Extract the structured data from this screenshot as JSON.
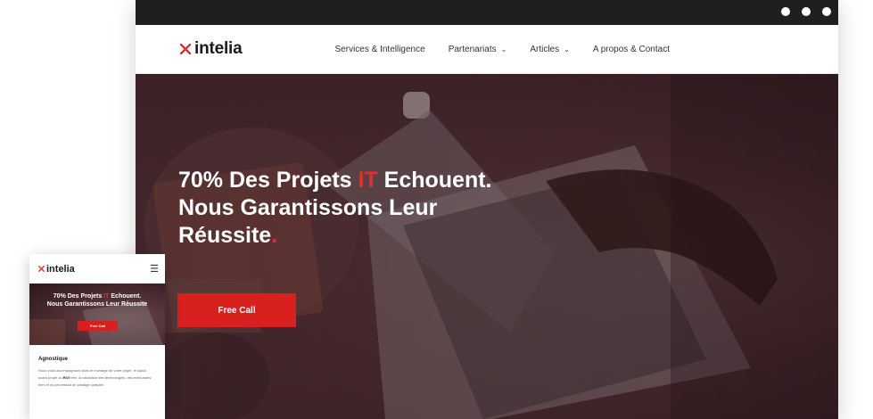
{
  "window": {
    "dots": [
      "dot",
      "dot",
      "dot"
    ]
  },
  "desktop": {
    "logo": "intelia",
    "nav": [
      {
        "label": "Services & Intelligence",
        "dropdown": false
      },
      {
        "label": "Partenariats",
        "dropdown": true
      },
      {
        "label": "Articles",
        "dropdown": true
      },
      {
        "label": "A propos & Contact",
        "dropdown": false
      }
    ],
    "hero": {
      "line1_before": "70% Des Projets ",
      "line1_red": "IT",
      "line1_after": " Echouent.",
      "line2": "Nous Garantissons Leur",
      "line3": "Réussite",
      "dot": ".",
      "cta": "Free Call"
    }
  },
  "mobile": {
    "logo": "intelia",
    "menu_icon": "hamburger-icon",
    "hero": {
      "line1_before": "70% Des Projets ",
      "line1_red": "IT",
      "line1_after": " Echouent.",
      "line2": "Nous Garantissons Leur Réussite",
      "cta": "Free Call"
    },
    "section_title": "Agnostique",
    "text_before": "Nous vous accompagnons dans le montage de votre projet, le calcul avant-projet du ",
    "text_bold": "ROI",
    "text_after": " réel, la validation des technologies, des exécutants tiers et du processus de pilotage complet."
  },
  "colors": {
    "brand_red": "#d8201f",
    "dark": "#1f1f22"
  }
}
